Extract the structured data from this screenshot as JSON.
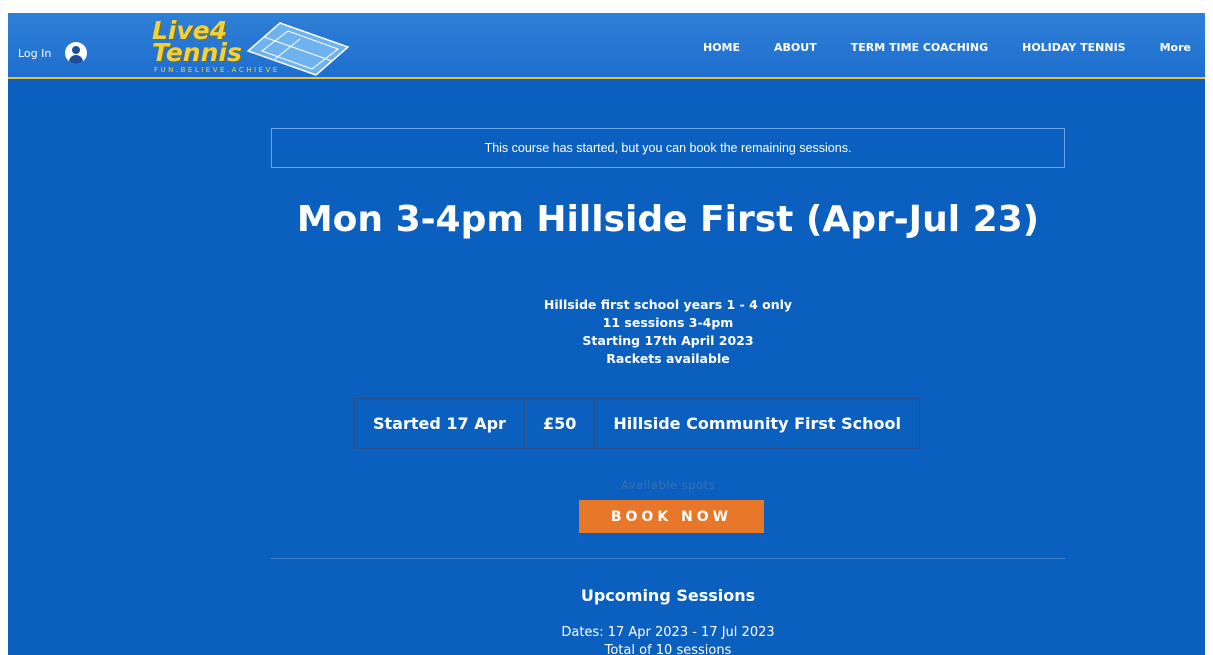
{
  "header": {
    "login_label": "Log In",
    "logo": {
      "line1": "Live4",
      "line2": "Tennis",
      "tagline": "FUN.BELIEVE.ACHIEVE"
    },
    "nav": [
      "HOME",
      "ABOUT",
      "TERM TIME COACHING",
      "HOLIDAY TENNIS",
      "More"
    ]
  },
  "notice": "This course has started, but you can book the remaining sessions.",
  "course": {
    "title": "Mon 3-4pm Hillside First (Apr-Jul 23)",
    "description": [
      "Hillside first school years 1 - 4 only",
      "11 sessions 3-4pm",
      "Starting 17th April 2023",
      "Rackets available"
    ],
    "started": "Started 17 Apr",
    "price": "£50",
    "location": "Hillside Community First School"
  },
  "booking": {
    "spots_label": "Available spots",
    "button_label": "BOOK NOW"
  },
  "sessions": {
    "heading": "Upcoming Sessions",
    "dates": "Dates: 17 Apr 2023 - 17 Jul 2023",
    "total": "Total of 10 sessions"
  },
  "colors": {
    "background": "#0b5fbf",
    "header": "#1e6fcf",
    "logo_yellow": "#f2d23c",
    "book_button": "#e8772a"
  },
  "icons": {
    "user": "account-circle-icon",
    "logo_court": "tennis-court-icon"
  }
}
